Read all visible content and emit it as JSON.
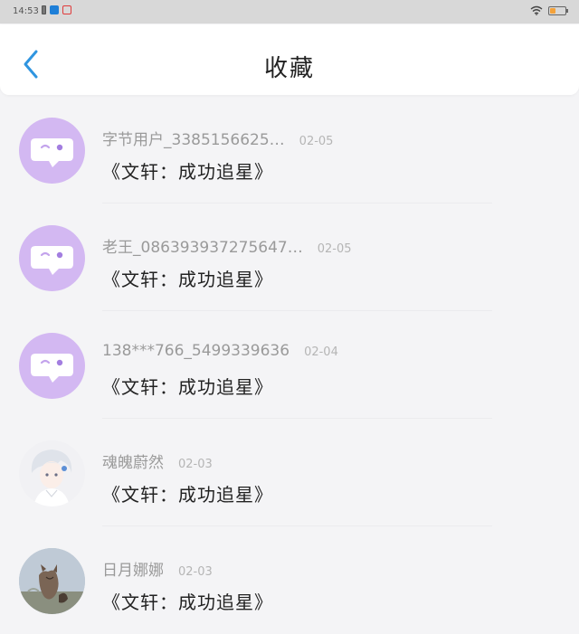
{
  "status": {
    "time": "14:53",
    "battery_level": 0.35,
    "battery_color": "#f4a23a",
    "icons_left": [
      "battery-mini-icon",
      "app-notification-icon",
      "app-notification-icon-2"
    ],
    "icons_right": [
      "wifi-icon",
      "battery-icon"
    ]
  },
  "header": {
    "title": "收藏",
    "back_icon": "chevron-left-icon",
    "accent_color": "#2f95e0"
  },
  "favorites": [
    {
      "user": "字节用户_3385156625…",
      "date": "02-05",
      "title": "《文轩：成功追星》",
      "avatar": "default-chat-avatar"
    },
    {
      "user": "老王_086393937275647…",
      "date": "02-05",
      "title": "《文轩：成功追星》",
      "avatar": "default-chat-avatar"
    },
    {
      "user": "138***766_5499339636",
      "date": "02-04",
      "title": "《文轩：成功追星》",
      "avatar": "default-chat-avatar"
    },
    {
      "user": "魂魄蔚然",
      "date": "02-03",
      "title": "《文轩：成功追星》",
      "avatar": "anime-avatar"
    },
    {
      "user": "日月娜娜",
      "date": "02-03",
      "title": "《文轩：成功追星》",
      "avatar": "cat-avatar"
    }
  ]
}
